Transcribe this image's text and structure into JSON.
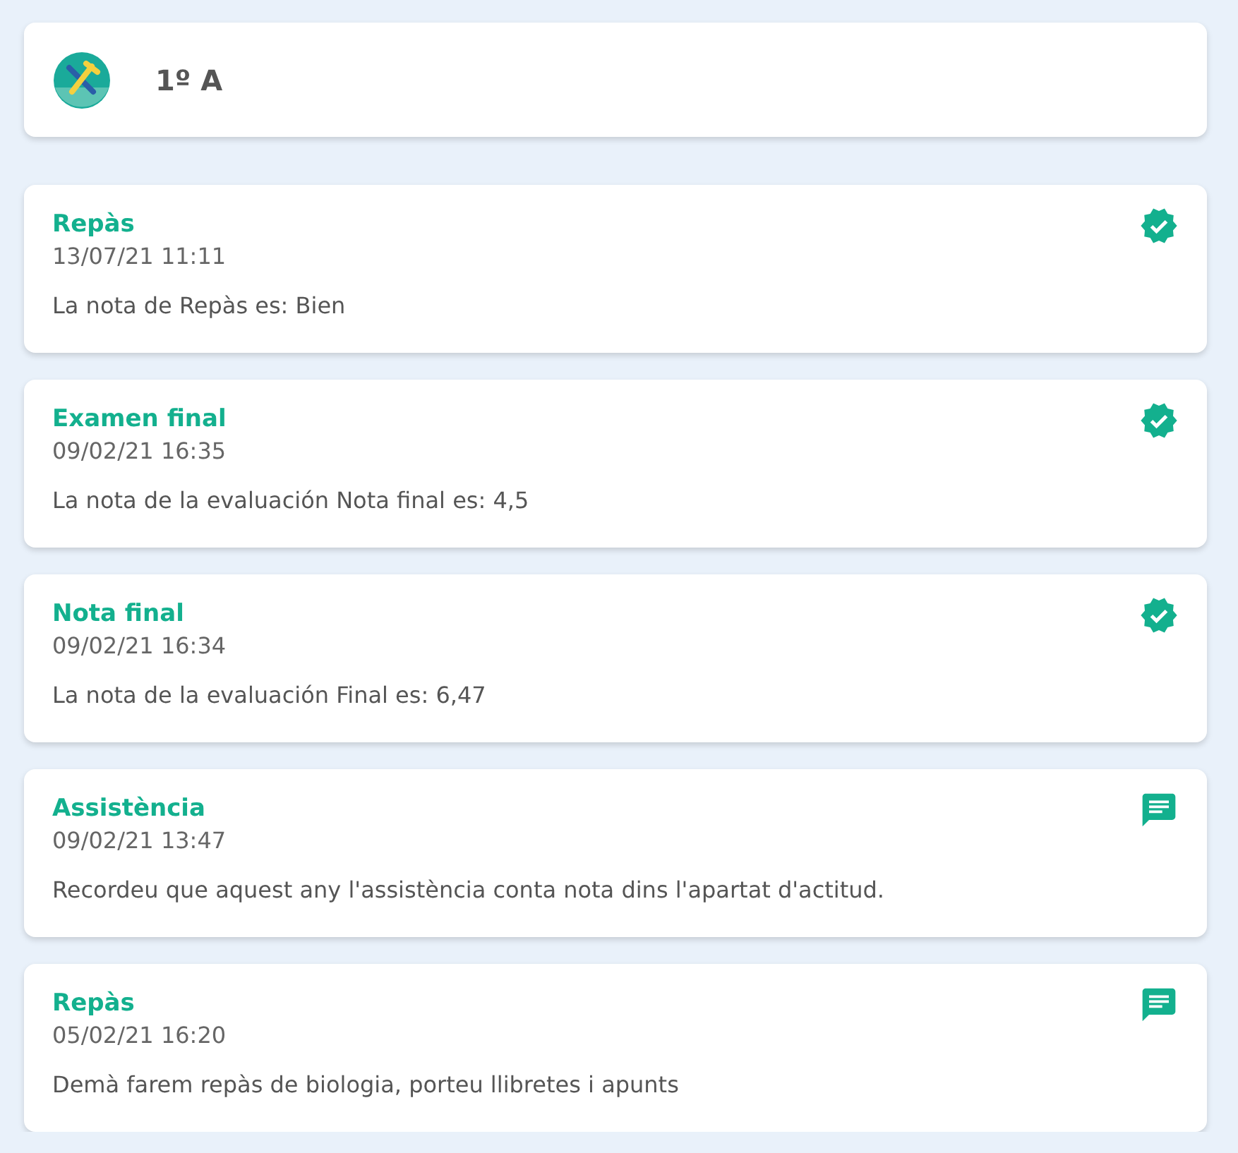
{
  "header": {
    "title": "1º A"
  },
  "notifications": [
    {
      "kind": "grade",
      "title": "Repàs",
      "date": "13/07/21 11:11",
      "text": "La nota de Repàs es: Bien"
    },
    {
      "kind": "grade",
      "title": "Examen final",
      "date": "09/02/21 16:35",
      "text": "La nota de la evaluación Nota final es: 4,5"
    },
    {
      "kind": "grade",
      "title": "Nota final",
      "date": "09/02/21 16:34",
      "text": "La nota de la evaluación Final es: 6,47"
    },
    {
      "kind": "message",
      "title": "Assistència",
      "date": "09/02/21 13:47",
      "text": "Recordeu que aquest any l'assistència conta nota dins l'apartat d'actitud."
    },
    {
      "kind": "message",
      "title": "Repàs",
      "date": "05/02/21 16:20",
      "text": "Demà farem repàs de biologia, porteu llibretes i apunts"
    }
  ]
}
